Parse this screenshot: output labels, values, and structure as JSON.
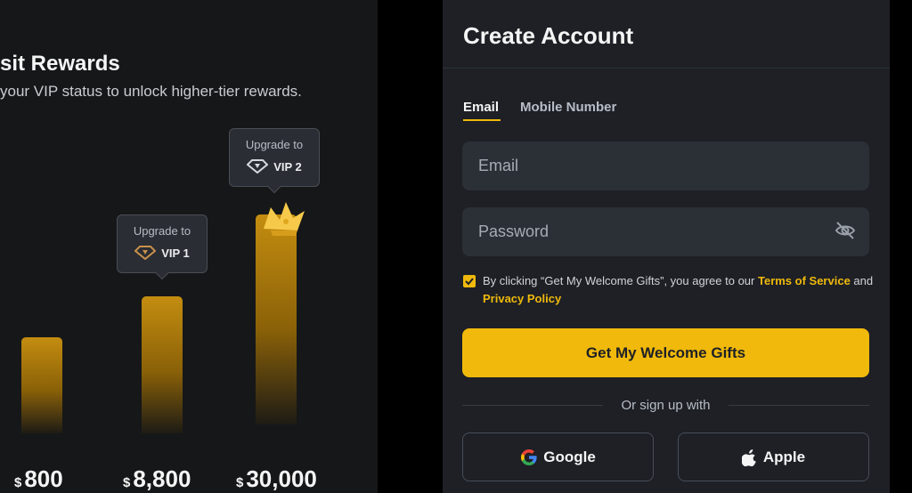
{
  "promo": {
    "title": "sit Rewards",
    "subtitle": "your VIP status to unlock higher-tier rewards.",
    "tooltips": [
      {
        "label": "Upgrade to",
        "vip": "VIP 1"
      },
      {
        "label": "Upgrade to",
        "vip": "VIP 2"
      }
    ],
    "amounts": [
      {
        "currency": "$",
        "value": "800"
      },
      {
        "currency": "$",
        "value": "8,800"
      },
      {
        "currency": "$",
        "value": "30,000"
      }
    ]
  },
  "form": {
    "title": "Create Account",
    "tabs": [
      {
        "label": "Email",
        "active": true
      },
      {
        "label": "Mobile Number",
        "active": false
      }
    ],
    "email": {
      "placeholder": "Email",
      "value": ""
    },
    "password": {
      "placeholder": "Password",
      "value": ""
    },
    "consent": {
      "checked": true,
      "prefix": "By clicking “Get My Welcome Gifts”, you agree to our ",
      "terms": "Terms of Service",
      "and": " and ",
      "privacy": "Privacy Policy"
    },
    "cta": "Get My Welcome Gifts",
    "divider": "Or sign up with",
    "social": [
      {
        "label": "Google",
        "icon": "google-icon"
      },
      {
        "label": "Apple",
        "icon": "apple-icon"
      }
    ]
  },
  "colors": {
    "accent": "#f0b90b",
    "panel": "#1e2026",
    "field": "#2b2f36",
    "background": "#000000"
  }
}
